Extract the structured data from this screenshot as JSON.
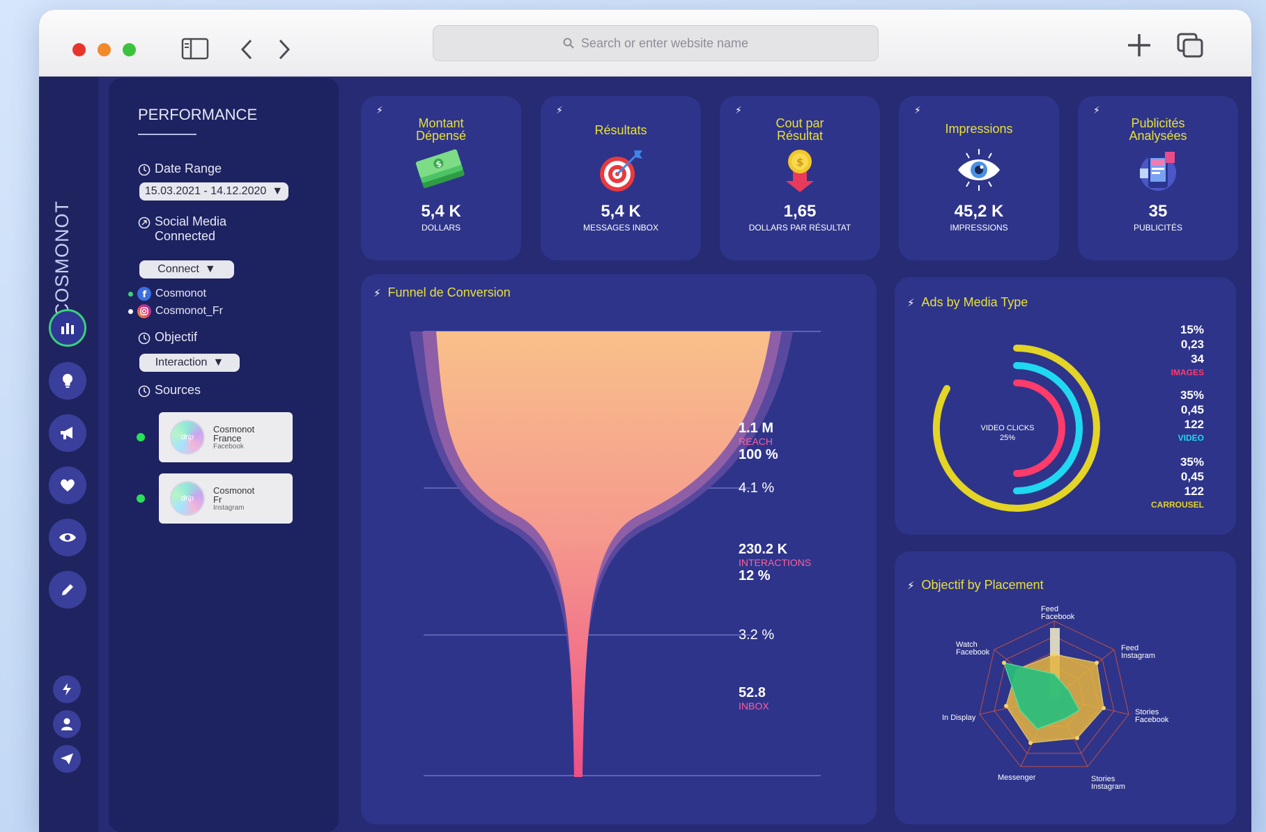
{
  "browser": {
    "search_placeholder": "Search or enter website name"
  },
  "rail": {
    "brand": "COSMONOT"
  },
  "sidebar": {
    "title": "PERFORMANCE",
    "date_range_label": "Date Range",
    "date_range_value": "15.03.2021 - 14.12.2020",
    "social_label_1": "Social Media",
    "social_label_2": "Connected",
    "connect_value": "Connect",
    "accounts": [
      {
        "name": "Cosmonot",
        "network": "facebook"
      },
      {
        "name": "Cosmonot_Fr",
        "network": "instagram"
      }
    ],
    "objectif_label": "Objectif",
    "objectif_value": "Interaction",
    "sources_label": "Sources",
    "sources": [
      {
        "line1": "Cosmonot",
        "line2": "France",
        "platform": "Facebook"
      },
      {
        "line1": "Cosmonot",
        "line2": "Fr",
        "platform": "Instagram"
      }
    ]
  },
  "kpis": [
    {
      "title_1": "Montant",
      "title_2": "Dépensé",
      "value": "5,4 K",
      "unit": "DOLLARS",
      "icon": "money-icon"
    },
    {
      "title_1": "Résultats",
      "title_2": "",
      "value": "5,4 K",
      "unit": "MESSAGES INBOX",
      "icon": "target-icon"
    },
    {
      "title_1": "Cout par",
      "title_2": "Résultat",
      "value": "1,65",
      "unit": "DOLLARS PAR RÉSULTAT",
      "icon": "coin-down-icon"
    },
    {
      "title_1": "Impressions",
      "title_2": "",
      "value": "45,2 K",
      "unit": "IMPRESSIONS",
      "icon": "eye-icon"
    },
    {
      "title_1": "Publicités",
      "title_2": "Analysées",
      "value": "35",
      "unit": "PUBLICITÉS",
      "icon": "phone-ads-icon"
    }
  ],
  "funnel": {
    "title": "Funnel de Conversion",
    "reach_value": "1.1 M",
    "reach_label": "REACH",
    "reach_pct": "100 %",
    "rate_1": "4.1 %",
    "interactions_value": "230.2 K",
    "interactions_label": "INTERACTIONS",
    "interactions_pct": "12 %",
    "rate_2": "3.2 %",
    "inbox_value": "52.8",
    "inbox_label": "INBOX"
  },
  "ads_media": {
    "title": "Ads by Media Type",
    "center_label": "VIDEO CLICKS",
    "center_value": "25%",
    "groups": [
      {
        "pct": "15%",
        "v1": "0,23",
        "v2": "34",
        "cat": "IMAGES",
        "color": "#ff3b6b"
      },
      {
        "pct": "35%",
        "v1": "0,45",
        "v2": "122",
        "cat": "VIDEO",
        "color": "#20d8f0"
      },
      {
        "pct": "35%",
        "v1": "0,45",
        "v2": "122",
        "cat": "CARROUSEL",
        "color": "#e3d426"
      }
    ]
  },
  "placement": {
    "title": "Objectif by Placement",
    "labels": {
      "feed_facebook_1": "Feed",
      "feed_facebook_2": "Facebook",
      "feed_instagram_1": "Feed",
      "feed_instagram_2": "Instagram",
      "stories_facebook_1": "Stories",
      "stories_facebook_2": "Facebook",
      "stories_instagram_1": "Stories",
      "stories_instagram_2": "Instagram",
      "messenger": "Messenger",
      "in_display": "In Display",
      "watch_facebook_1": "Watch",
      "watch_facebook_2": "Facebook"
    }
  },
  "colors": {
    "accent_yellow": "#e8e03a",
    "accent_pink": "#ff5f9e",
    "panel": "#2e348a",
    "background": "#262b73",
    "active_green": "#39d27a"
  }
}
